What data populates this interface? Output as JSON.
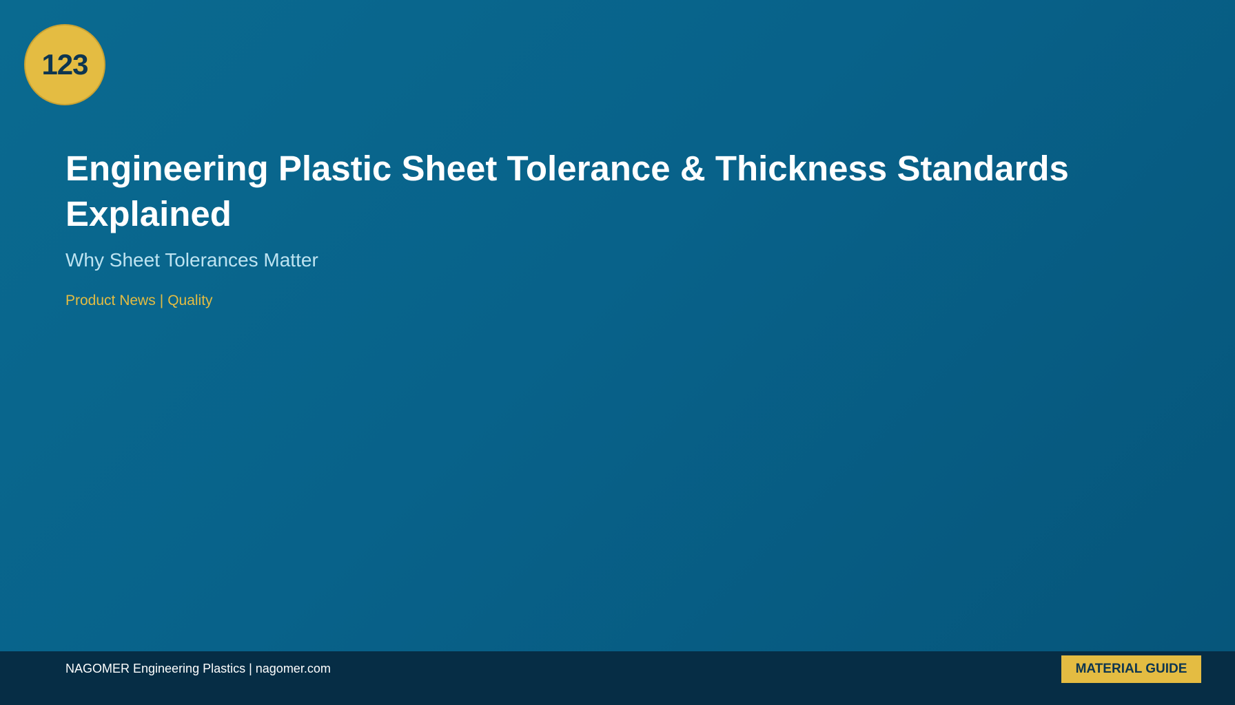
{
  "badge": {
    "number": "123"
  },
  "article": {
    "title": "Engineering Plastic Sheet Tolerance & Thickness Standards Explained",
    "subtitle": "Why Sheet Tolerances Matter",
    "categories": [
      "Product News",
      "Quality"
    ],
    "category_separator": "|"
  },
  "footer": {
    "brand": "NAGOMER Engineering Plastics | nagomer.com",
    "tag": "MATERIAL GUIDE"
  },
  "colors": {
    "background": "#08628a",
    "accent": "#e4bc42",
    "footer": "#062d45",
    "title": "#ffffff",
    "subtitle": "#bde3f1"
  }
}
